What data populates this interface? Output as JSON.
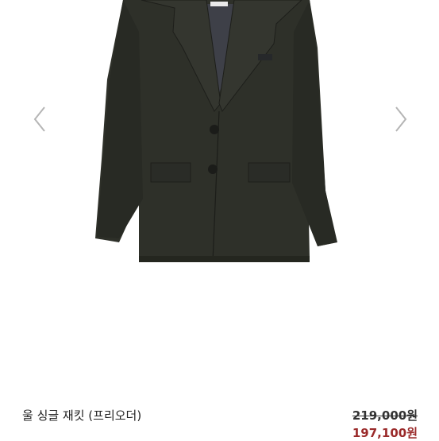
{
  "product": {
    "title": "울 싱글 재킷 (프리오더)",
    "price_original": "219,000원",
    "price_sale": "197,100원"
  },
  "gallery": {
    "prev_icon": "chevron-left-icon",
    "next_icon": "chevron-right-icon",
    "image_subject": "dark olive wool single-breasted jacket"
  },
  "colors": {
    "jacket": "#2e3029",
    "sale_price": "#9a2a2a",
    "arrow": "#b5b5b5"
  }
}
